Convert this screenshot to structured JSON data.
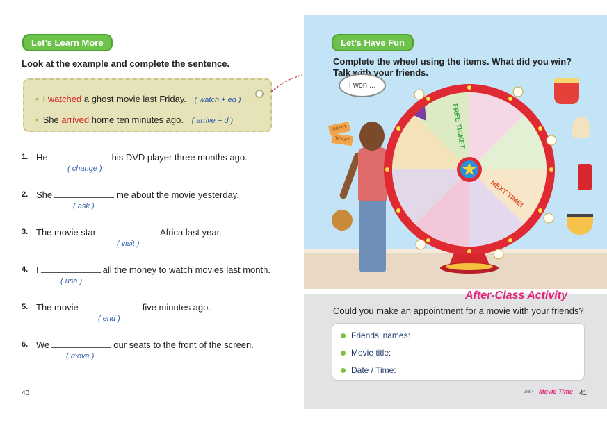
{
  "left": {
    "section_title": "Let’s Learn More",
    "instruction": "Look at the example and complete the sentence.",
    "examples": [
      {
        "pre": "I",
        "verb": "watched",
        "post": "a ghost movie last Friday.",
        "hint": "( watch + ed )"
      },
      {
        "pre": "She",
        "verb": "arrived",
        "post": "home ten minutes ago.",
        "hint": "( arrive + d )"
      }
    ],
    "questions": [
      {
        "num": "1.",
        "before": "He",
        "after": "his DVD player three months ago.",
        "hint": "( change )"
      },
      {
        "num": "2.",
        "before": "She",
        "after": "me about the movie yesterday.",
        "hint": "( ask )"
      },
      {
        "num": "3.",
        "before": "The movie star",
        "after": "Africa last year.",
        "hint": "( visit )"
      },
      {
        "num": "4.",
        "before": "I",
        "after": "all the money to watch movies last month.",
        "hint": "( use )"
      },
      {
        "num": "5.",
        "before": "The movie",
        "after": "five minutes ago.",
        "hint": "( end )"
      },
      {
        "num": "6.",
        "before": "We",
        "after": "our seats to the front of the screen.",
        "hint": "( move )"
      }
    ],
    "page_number": "40"
  },
  "right": {
    "section_title": "Let’s Have Fun",
    "instruction_line1": "Complete the wheel using the items. What did you win?",
    "instruction_line2": "Talk with your friends.",
    "bubble": "I won ...",
    "wheel_labels": {
      "free_ticket": "FREE TICKET",
      "next_time": "NEXT TIME!"
    },
    "ticket_label": "TICKET",
    "after_class_title": "After-Class Activity",
    "question": "Could you make an appointment for a movie with your friends?",
    "fields": [
      "Friends’ names:",
      "Movie title:",
      "Date / Time:"
    ],
    "unit_label": "unit 4",
    "unit_title": "Movie Time",
    "page_number": "41"
  }
}
